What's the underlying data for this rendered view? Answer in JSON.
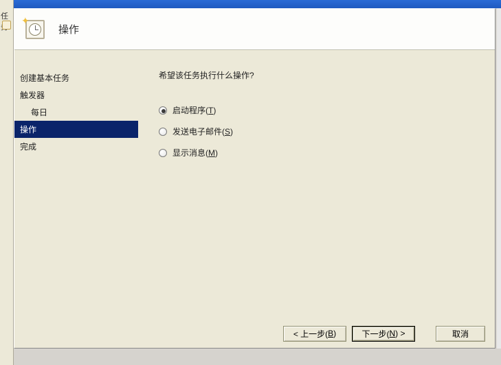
{
  "background": {
    "left_label": "任务"
  },
  "dialog": {
    "title": "操作",
    "nav": [
      {
        "label": "创建基本任务",
        "indent": false,
        "selected": false
      },
      {
        "label": "触发器",
        "indent": false,
        "selected": false
      },
      {
        "label": "每日",
        "indent": true,
        "selected": false
      },
      {
        "label": "操作",
        "indent": false,
        "selected": true
      },
      {
        "label": "完成",
        "indent": false,
        "selected": false
      }
    ],
    "question": "希望该任务执行什么操作?",
    "options": [
      {
        "label_pre": "启动程序(",
        "key": "T",
        "label_post": ")",
        "checked": true
      },
      {
        "label_pre": "发送电子邮件(",
        "key": "S",
        "label_post": ")",
        "checked": false
      },
      {
        "label_pre": "显示消息(",
        "key": "M",
        "label_post": ")",
        "checked": false
      }
    ],
    "buttons": {
      "back": {
        "pre": "< 上一步(",
        "key": "B",
        "post": ")"
      },
      "next": {
        "pre": "下一步(",
        "key": "N",
        "post": ") >"
      },
      "cancel": "取消"
    }
  }
}
